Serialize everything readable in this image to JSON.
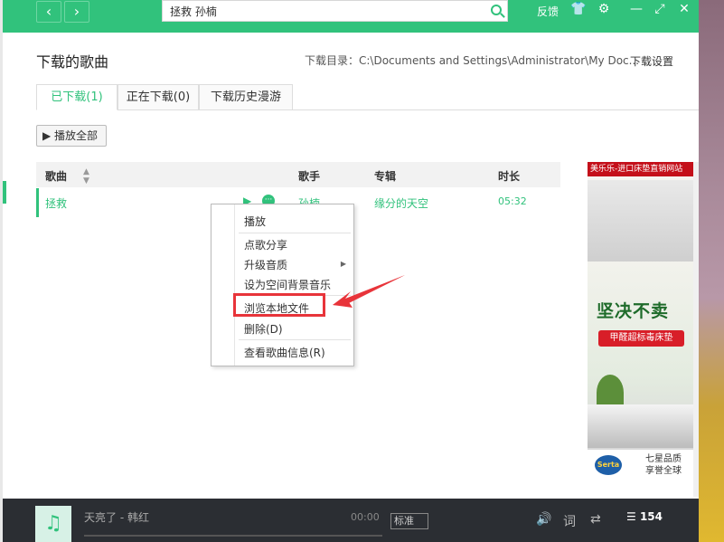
{
  "topbar": {
    "search_value": "拯救 孙楠",
    "feedback_label": "反馈",
    "nav_back": "‹",
    "nav_forward": "›"
  },
  "header": {
    "title": "下载的歌曲",
    "download_dir": "下载目录：C:\\Documents and Settings\\Administrator\\My Doc...",
    "settings_label": "下载设置"
  },
  "tabs": [
    {
      "label": "已下载(1)",
      "active": true
    },
    {
      "label": "正在下载(0)",
      "active": false
    },
    {
      "label": "下载历史漫游",
      "active": false
    }
  ],
  "play_all_label": "▶ 播放全部",
  "table": {
    "headers": {
      "song": "歌曲",
      "singer": "歌手",
      "album": "专辑",
      "duration": "时长"
    },
    "rows": [
      {
        "song": "拯救",
        "singer": "孙楠",
        "album": "缘分的天空",
        "duration": "05:32"
      }
    ]
  },
  "context_menu": {
    "items": [
      {
        "label": "播放"
      },
      {
        "label": "点歌分享"
      },
      {
        "label": "升级音质"
      },
      {
        "label": "设为空间背景音乐"
      },
      {
        "label": "浏览本地文件"
      },
      {
        "label": "删除(D)"
      },
      {
        "label": "查看歌曲信息(R)"
      }
    ]
  },
  "ad": {
    "header": "美乐乐-进口床垫直销网站",
    "slogan": "坚决不卖",
    "badge": "甲醛超标毒床垫",
    "logo": "Serta",
    "footer_line1": "七星品质",
    "footer_line2": "享誉全球"
  },
  "player": {
    "now_playing": "天亮了 - 韩红",
    "time": "00:00",
    "quality": "标准",
    "list_count": "154"
  },
  "colors": {
    "accent": "#31c27c",
    "highlight": "#e8343a"
  }
}
